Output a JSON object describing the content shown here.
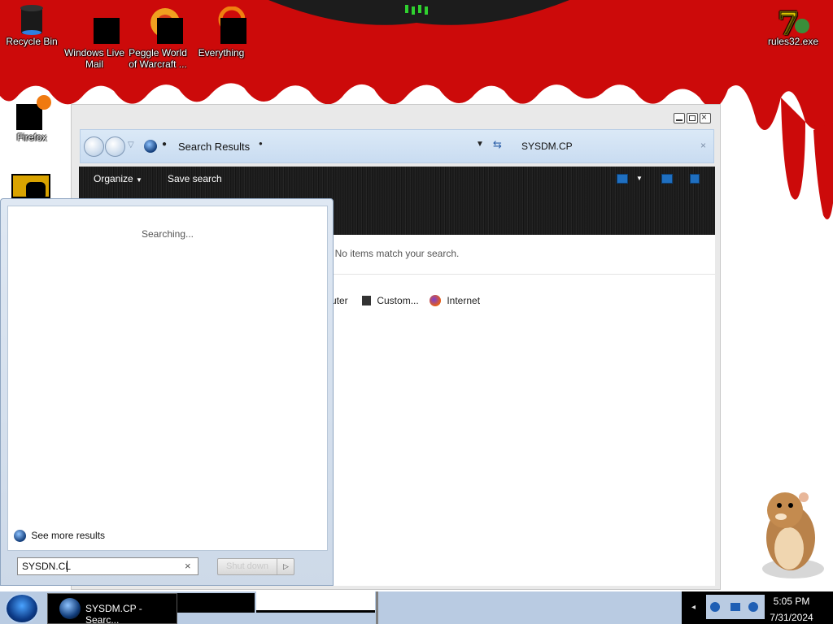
{
  "desktop": {
    "icons": [
      {
        "label": "Recycle Bin",
        "icon": "recycle-bin-icon"
      },
      {
        "label": "Windows Live Mail",
        "icon": "mail-icon"
      },
      {
        "label": "Peggle World of Warcraft ...",
        "icon": "peggle-icon"
      },
      {
        "label": "Everything",
        "icon": "search-app-icon"
      },
      {
        "label": "rules32.exe",
        "icon": "exe-icon"
      },
      {
        "label": "Firefox",
        "icon": "firefox-icon"
      }
    ]
  },
  "explorer": {
    "address_title": "Search Results",
    "search_query": "SYSDM.CP",
    "toolbar": {
      "organize": "Organize",
      "save_search": "Save search"
    },
    "no_items": "No items match your search.",
    "locations": [
      "uter",
      "Custom...",
      "Internet"
    ]
  },
  "start_menu": {
    "status": "Searching...",
    "see_more": "See more results",
    "search_value": "SYSDN.CL",
    "go_label": "Shut down"
  },
  "taskbar": {
    "task_label": "SYSDM.CP - Searc...",
    "time": "5:05 PM",
    "date": "7/31/2024"
  }
}
